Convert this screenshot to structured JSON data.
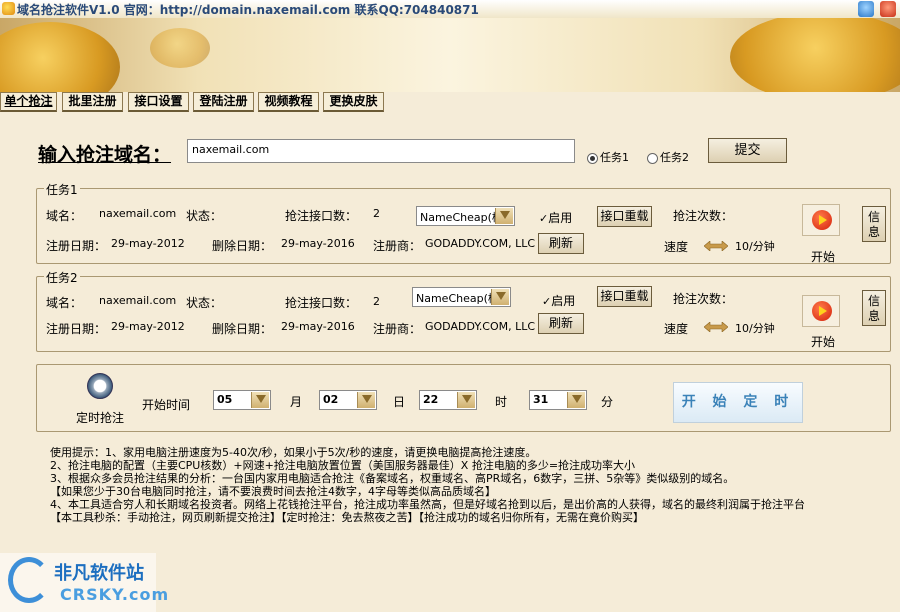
{
  "window": {
    "title": "域名抢注软件V1.0 官网：http://domain.naxemail.com 联系QQ:704840871"
  },
  "tabs": [
    {
      "label": "单个抢注"
    },
    {
      "label": "批里注册"
    },
    {
      "label": "接口设置"
    },
    {
      "label": "登陆注册"
    },
    {
      "label": "视频教程"
    },
    {
      "label": "更换皮肤"
    }
  ],
  "domain_input": {
    "label": "输入抢注域名：",
    "value": "naxemail.com"
  },
  "task_radios": [
    {
      "label": "任务1",
      "selected": true
    },
    {
      "label": "任务2",
      "selected": false
    }
  ],
  "submit_label": "提交",
  "tasks": [
    {
      "group_title": "任务1",
      "domain_label": "域名：",
      "domain_value": "naxemail.com",
      "status_label": "状态：",
      "status_value": "",
      "api_count_label": "抢注接口数：",
      "api_count_value": "2",
      "registrar_select": "NameCheap(模拟",
      "enable_label": "启用",
      "enabled": true,
      "reload_label": "接口重载",
      "count_label": "抢注次数：",
      "count_value": "",
      "info_label": "信息",
      "reg_date_label": "注册日期：",
      "reg_date_value": "29-may-2012",
      "del_date_label": "删除日期：",
      "del_date_value": "29-may-2016",
      "registrar_label": "注册商：",
      "registrar_value": "GODADDY.COM, LLC",
      "refresh_label": "刷新",
      "speed_label": "速度",
      "speed_value": "10/分钟",
      "start_label": "开始"
    },
    {
      "group_title": "任务2",
      "domain_label": "域名：",
      "domain_value": "naxemail.com",
      "status_label": "状态：",
      "status_value": "",
      "api_count_label": "抢注接口数：",
      "api_count_value": "2",
      "registrar_select": "NameCheap(模拟",
      "enable_label": "启用",
      "enabled": true,
      "reload_label": "接口重载",
      "count_label": "抢注次数：",
      "count_value": "",
      "info_label": "信息",
      "reg_date_label": "注册日期：",
      "reg_date_value": "29-may-2012",
      "del_date_label": "删除日期：",
      "del_date_value": "29-may-2016",
      "registrar_label": "注册商：",
      "registrar_value": "GODADDY.COM, LLC",
      "refresh_label": "刷新",
      "speed_label": "速度",
      "speed_value": "10/分钟",
      "start_label": "开始"
    }
  ],
  "timer": {
    "icon_label": "定时抢注",
    "start_time_label": "开始时间",
    "month_value": "05",
    "month_label": "月",
    "day_value": "02",
    "day_label": "日",
    "hour_value": "22",
    "hour_label": "时",
    "minute_value": "31",
    "minute_label": "分",
    "start_button": "开 始 定 时"
  },
  "tips": [
    "使用提示：1、家用电脑注册速度为5-40次/秒，如果小于5次/秒的速度，请更换电脑提高抢注速度。",
    "2、抢注电脑的配置（主要CPU核数）+网速+抢注电脑放置位置（美国服务器最佳）X 抢注电脑的多少=抢注成功率大小",
    "3、根据众多会员抢注结果的分析：一台国内家用电脑适合抢注《备案域名，权重域名、高PR域名，6数字，三拼、5杂等》类似级别的域名。",
    "【如果您少于30台电脑同时抢注，请不要浪费时间去抢注4数字，4字母等类似高品质域名】",
    "4、本工具适合穷人和长期域名投资者。网络上花钱抢注平台，抢注成功率虽然高，但是好域名抢到以后，是出价高的人获得，域名的最终利润属于抢注平台",
    "【本工具秒杀：手动抢注，网页刷新提交抢注】【定时抢注：免去熬夜之苦】【抢注成功的域名归你所有，无需在竟价购买】"
  ],
  "watermark": {
    "name": "非凡软件站",
    "domain": "CRSKY.com"
  }
}
